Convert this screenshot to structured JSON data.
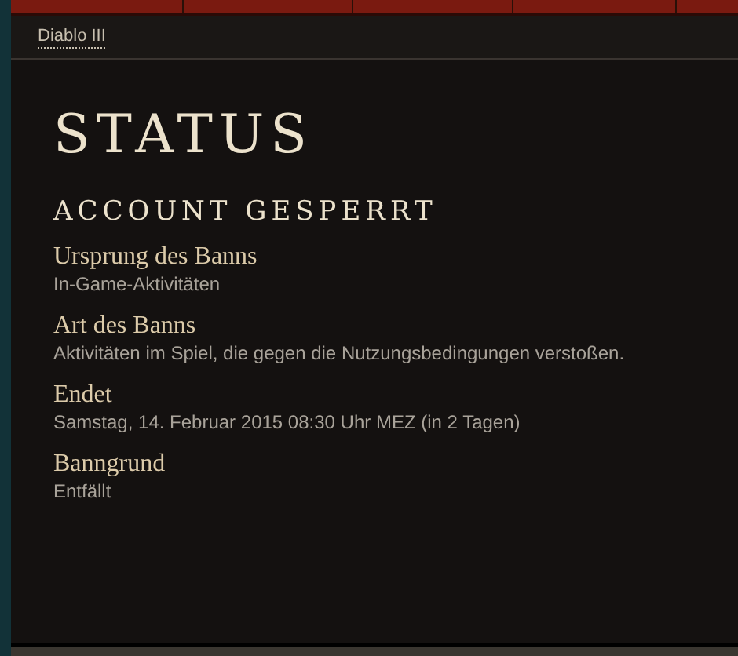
{
  "breadcrumb": {
    "label": "Diablo III"
  },
  "title": "STATUS",
  "subtitle": "ACCOUNT GESPERRT",
  "fields": [
    {
      "label": "Ursprung des Banns",
      "value": "In-Game-Aktivitäten"
    },
    {
      "label": "Art des Banns",
      "value": "Aktivitäten im Spiel, die gegen die Nutzungsbedingungen verstoßen."
    },
    {
      "label": "Endet",
      "value": "Samstag, 14. Februar 2015 08:30 Uhr MEZ (in 2 Tagen)"
    },
    {
      "label": "Banngrund",
      "value": "Entfällt"
    }
  ]
}
